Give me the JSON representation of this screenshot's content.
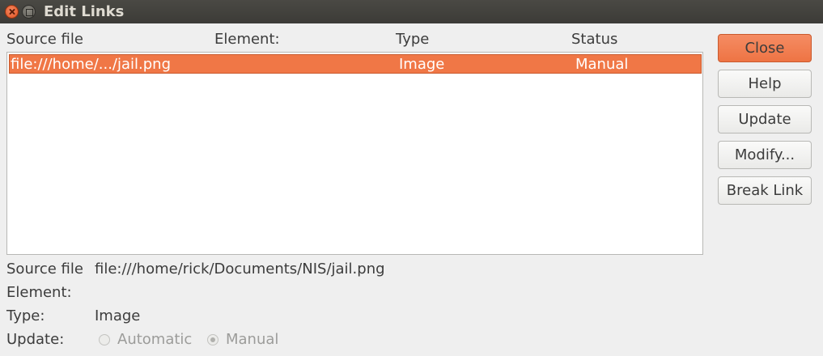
{
  "window": {
    "title": "Edit Links"
  },
  "columns": [
    "Source file",
    "Element:",
    "Type",
    "Status"
  ],
  "links": [
    {
      "source": "file:///home/.../jail.png",
      "element": "",
      "type": "Image",
      "status": "Manual"
    }
  ],
  "buttons": {
    "close": "Close",
    "help": "Help",
    "update": "Update",
    "modify": "Modify...",
    "break_link": "Break Link"
  },
  "details": {
    "source_label": "Source file",
    "source_value": "file:///home/rick/Documents/NIS/jail.png",
    "element_label": "Element:",
    "element_value": "",
    "type_label": "Type:",
    "type_value": "Image",
    "update_label": "Update:",
    "automatic_label": "Automatic",
    "manual_label": "Manual",
    "update_mode": "Manual"
  },
  "colors": {
    "accent": "#f07746",
    "titlebar": "#3c3b37",
    "background": "#efefef"
  }
}
